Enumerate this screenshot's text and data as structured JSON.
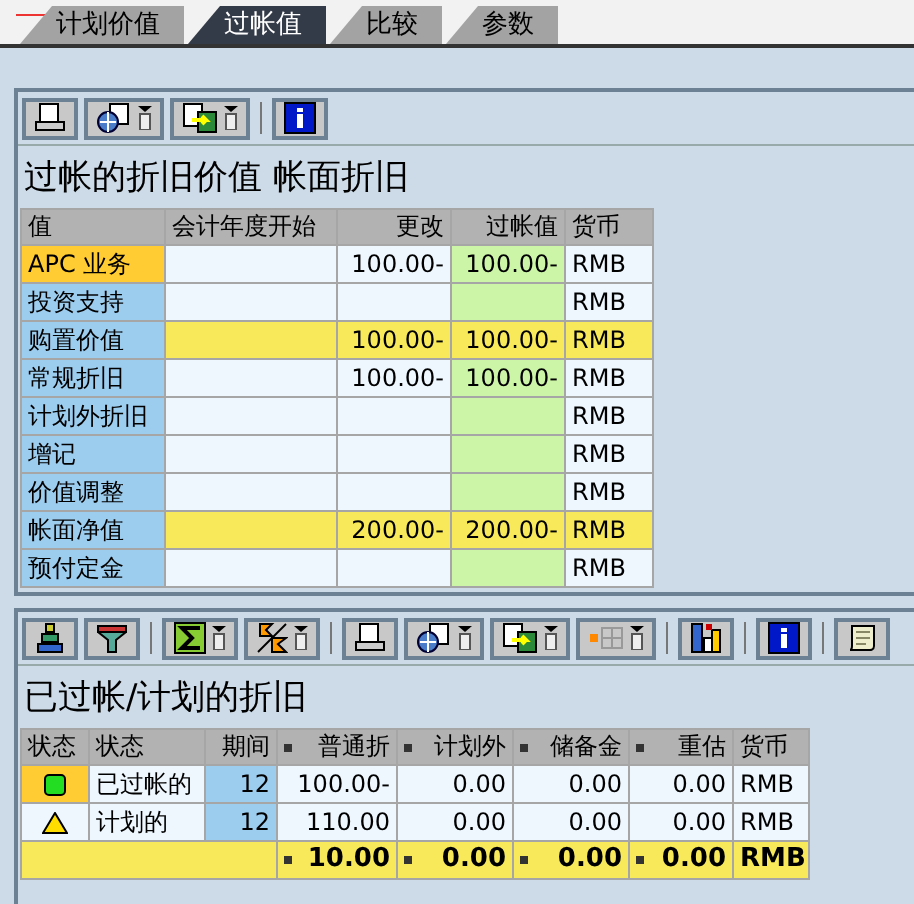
{
  "tabs": [
    {
      "label": "计划价值",
      "selected": false
    },
    {
      "label": "过帐值",
      "selected": true
    },
    {
      "label": "比较",
      "selected": false
    },
    {
      "label": "参数",
      "selected": false
    }
  ],
  "values_panel": {
    "title": "过帐的折旧价值 帐面折旧",
    "columns": [
      "值",
      "会计年度开始",
      "更改",
      "过帐值",
      "货币"
    ],
    "rows": [
      {
        "label": "APC 业务",
        "selected": true,
        "highlight": false,
        "fiscal_start": "",
        "change": "100.00-",
        "posted": "100.00-",
        "currency": "RMB"
      },
      {
        "label": "投资支持",
        "selected": false,
        "highlight": false,
        "fiscal_start": "",
        "change": "",
        "posted": "",
        "currency": "RMB"
      },
      {
        "label": "购置价值",
        "selected": false,
        "highlight": true,
        "fiscal_start": "",
        "change": "100.00-",
        "posted": "100.00-",
        "currency": "RMB"
      },
      {
        "label": "常规折旧",
        "selected": false,
        "highlight": false,
        "fiscal_start": "",
        "change": "100.00-",
        "posted": "100.00-",
        "currency": "RMB"
      },
      {
        "label": "计划外折旧",
        "selected": false,
        "highlight": false,
        "fiscal_start": "",
        "change": "",
        "posted": "",
        "currency": "RMB"
      },
      {
        "label": "增记",
        "selected": false,
        "highlight": false,
        "fiscal_start": "",
        "change": "",
        "posted": "",
        "currency": "RMB"
      },
      {
        "label": "价值调整",
        "selected": false,
        "highlight": false,
        "fiscal_start": "",
        "change": "",
        "posted": "",
        "currency": "RMB"
      },
      {
        "label": "帐面净值",
        "selected": false,
        "highlight": true,
        "fiscal_start": "",
        "change": "200.00-",
        "posted": "200.00-",
        "currency": "RMB"
      },
      {
        "label": "预付定金",
        "selected": false,
        "highlight": false,
        "fiscal_start": "",
        "change": "",
        "posted": "",
        "currency": "RMB"
      }
    ]
  },
  "depreciation_panel": {
    "title": "已过帐/计划的折旧",
    "columns": [
      {
        "label": "状态",
        "sum": false
      },
      {
        "label": "状态",
        "sum": false
      },
      {
        "label": "期间",
        "sum": false
      },
      {
        "label": "普通折",
        "sum": true
      },
      {
        "label": "计划外",
        "sum": true
      },
      {
        "label": "储备金",
        "sum": true
      },
      {
        "label": "重估",
        "sum": true
      },
      {
        "label": "货币",
        "sum": false
      }
    ],
    "rows": [
      {
        "kind": "posted",
        "selected": true,
        "status_text": "已过帐的",
        "period": "12",
        "ordinary": "100.00-",
        "unplanned": "0.00",
        "reserve": "0.00",
        "revaluation": "0.00",
        "currency": "RMB"
      },
      {
        "kind": "planned",
        "selected": false,
        "status_text": "计划的",
        "period": "12",
        "ordinary": "110.00",
        "unplanned": "0.00",
        "reserve": "0.00",
        "revaluation": "0.00",
        "currency": "RMB"
      }
    ],
    "total": {
      "ordinary": "10.00",
      "unplanned": "0.00",
      "reserve": "0.00",
      "revaluation": "0.00",
      "currency": "RMB"
    }
  }
}
